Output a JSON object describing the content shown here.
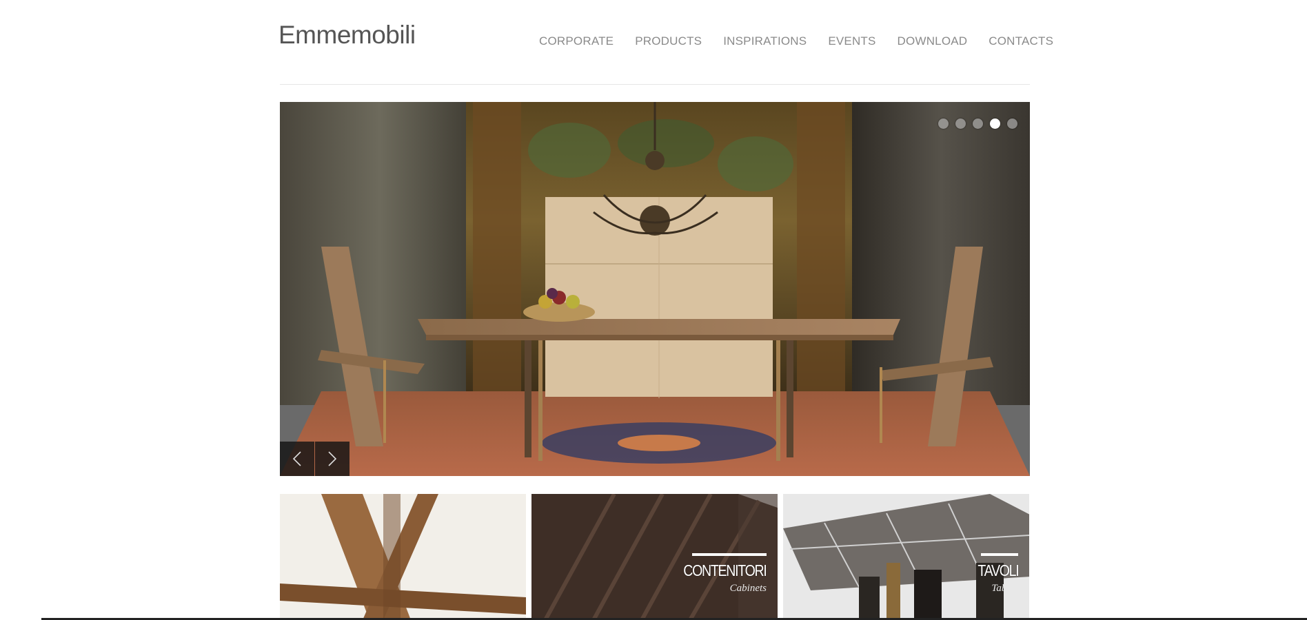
{
  "brand": {
    "logo_text": "Emmemobili"
  },
  "nav": {
    "items": [
      {
        "label": "CORPORATE"
      },
      {
        "label": "PRODUCTS"
      },
      {
        "label": "INSPIRATIONS"
      },
      {
        "label": "EVENTS"
      },
      {
        "label": "DOWNLOAD"
      },
      {
        "label": "CONTACTS"
      }
    ]
  },
  "slider": {
    "slide_count": 5,
    "active_slide": 4,
    "prev_icon": "chevron-left-icon",
    "next_icon": "chevron-right-icon"
  },
  "tiles": [
    {
      "title": "",
      "subtitle": ""
    },
    {
      "title": "CONTENITORI",
      "subtitle": "Cabinets"
    },
    {
      "title": "TAVOLI",
      "subtitle": "Tables"
    }
  ],
  "colors": {
    "nav_text": "#8a8a8a",
    "logo_text": "#555555",
    "rule": "#e6e6e6",
    "arrow_bg": "#141414"
  }
}
